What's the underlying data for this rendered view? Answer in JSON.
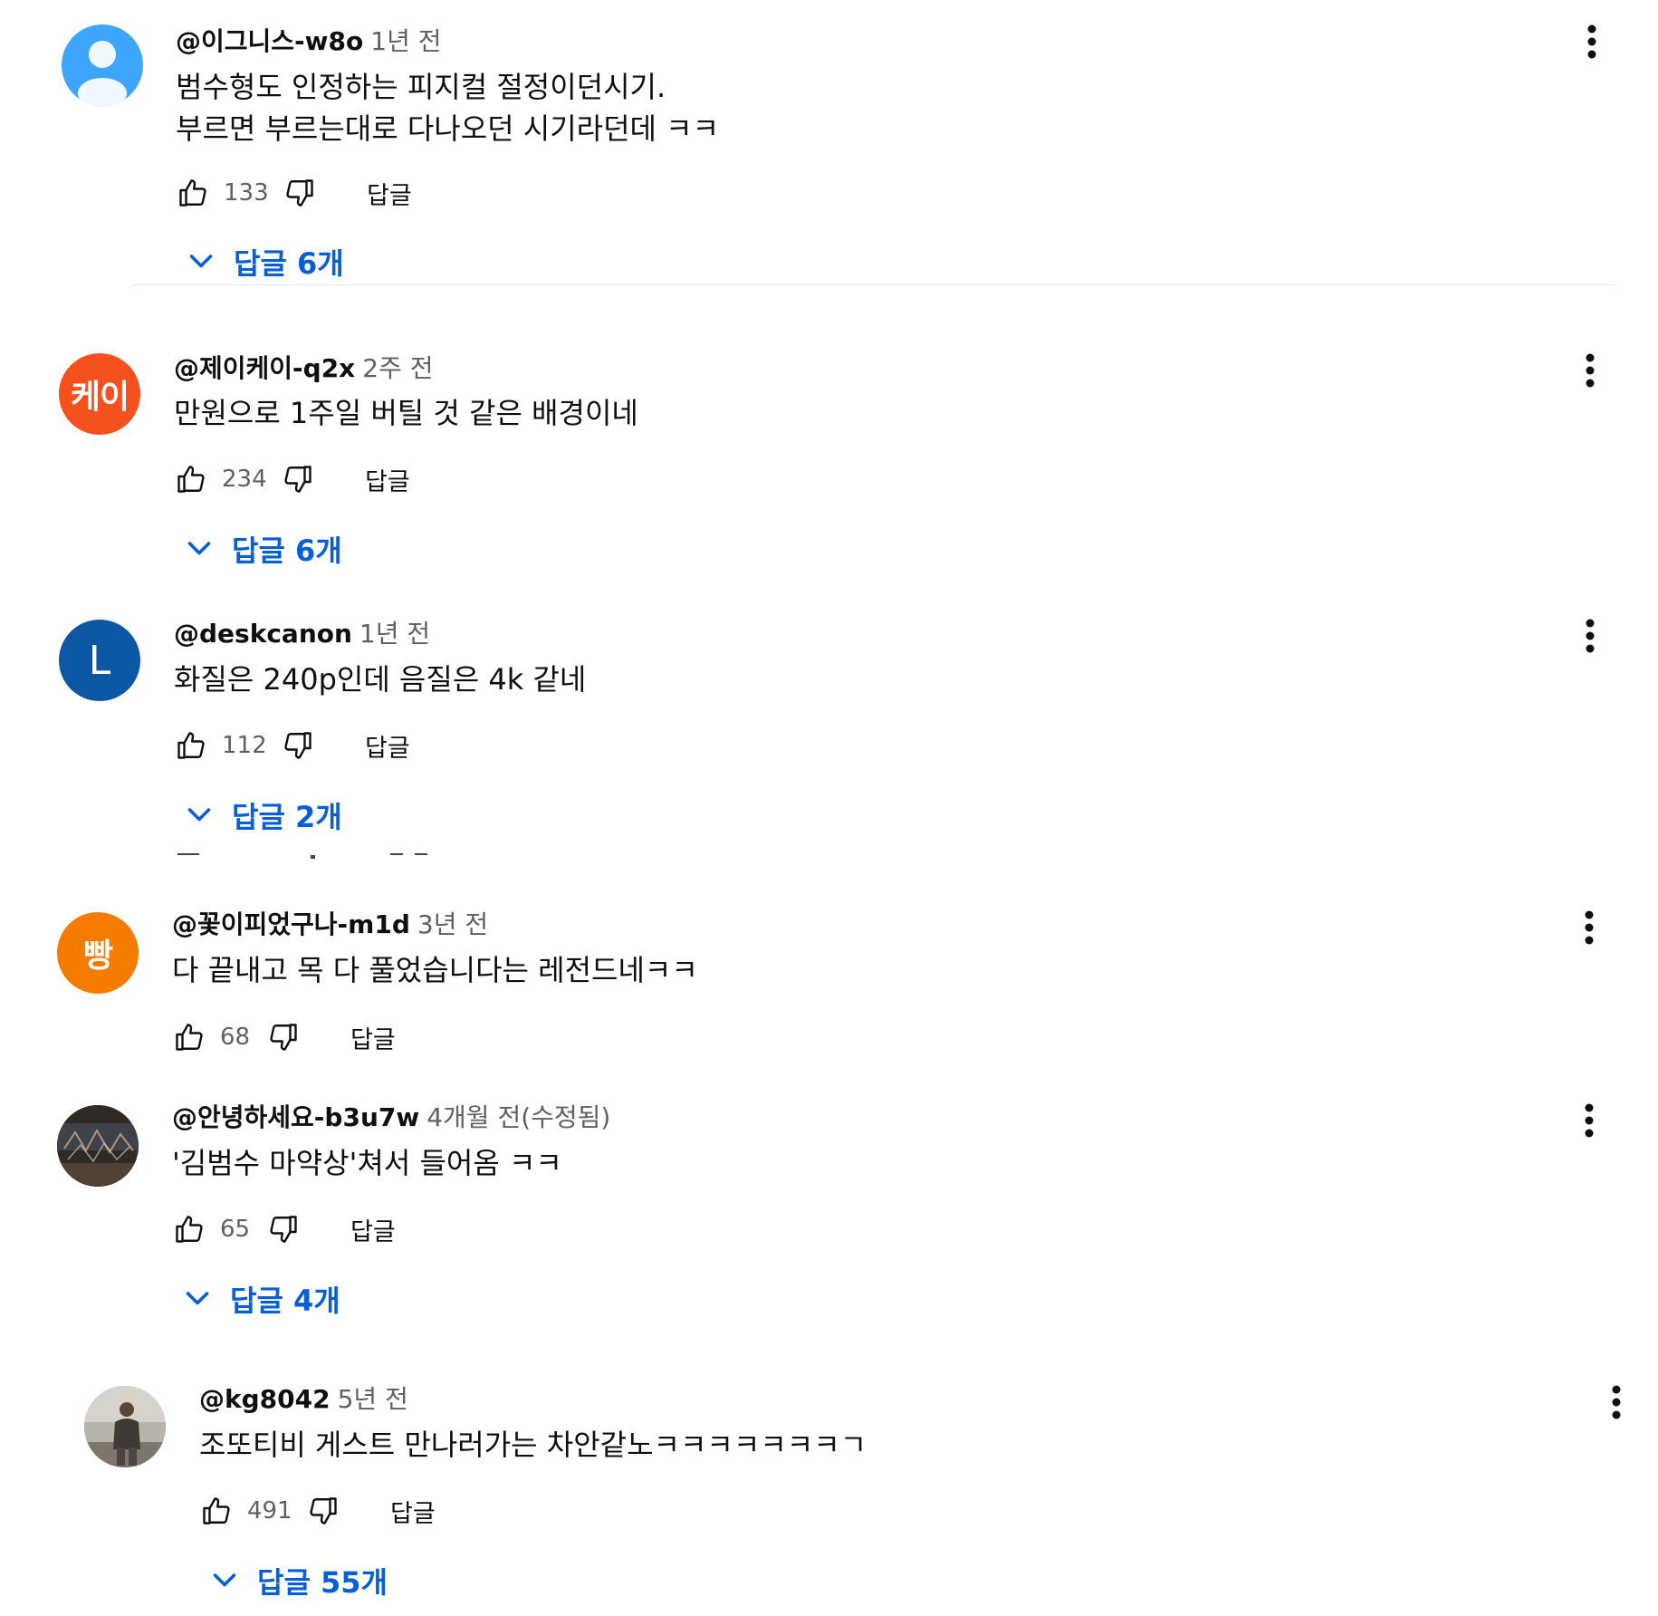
{
  "comments": [
    {
      "author": "@이그니스-w8o",
      "time": "1년 전",
      "avatar_label": "",
      "avatar_color": "#3ea6ff",
      "lines": [
        "범수형도 인정하는 피지컬 절정이던시기.",
        "부르면 부르는대로 다나오던 시기라던데 ㅋㅋ"
      ],
      "likes": "133",
      "reply_label": "답글",
      "replies_label": "답글 6개"
    },
    {
      "author": "@제이케이-q2x",
      "time": "2주 전",
      "avatar_label": "케이",
      "avatar_color": "#f4511e",
      "lines": [
        "만원으로 1주일 버틸 것 같은 배경이네"
      ],
      "likes": "234",
      "reply_label": "답글",
      "replies_label": "답글 6개"
    },
    {
      "author": "@deskcanon",
      "time": "1년 전",
      "avatar_label": "L",
      "avatar_color": "#0b57a4",
      "lines": [
        "화질은 240p인데 음질은 4k 같네"
      ],
      "likes": "112",
      "reply_label": "답글",
      "replies_label": "답글 2개"
    },
    {
      "author": "@꽃이피었구나-m1d",
      "time": "3년 전",
      "avatar_label": "빵",
      "avatar_color": "#f57c00",
      "lines": [
        "다 끝내고 목 다 풀었습니다는 레전드네ㅋㅋ"
      ],
      "likes": "68",
      "reply_label": "답글",
      "replies_label": ""
    },
    {
      "author": "@안녕하세요-b3u7w",
      "time": "4개월 전(수정됨)",
      "avatar_label": "",
      "avatar_color": "#3a3530",
      "lines": [
        "'김범수 마약상'쳐서 들어옴 ㅋㅋ"
      ],
      "likes": "65",
      "reply_label": "답글",
      "replies_label": "답글 4개"
    },
    {
      "author": "@kg8042",
      "time": "5년 전",
      "avatar_label": "",
      "avatar_color": "#8a8680",
      "lines": [
        "조또티비 게스트 만나러가는 차안같노ㅋㅋㅋㅋㅋㅋㅋㄱ"
      ],
      "likes": "491",
      "reply_label": "답글",
      "replies_label": "답글 55개"
    }
  ],
  "colors": {
    "link_blue": "#065fd4",
    "secondary_text": "#606060",
    "primary_text": "#0f0f0f"
  },
  "icons": {
    "like": "thumbs-up-icon",
    "dislike": "thumbs-down-icon",
    "more": "more-vert-icon",
    "expand": "chevron-down-icon"
  }
}
